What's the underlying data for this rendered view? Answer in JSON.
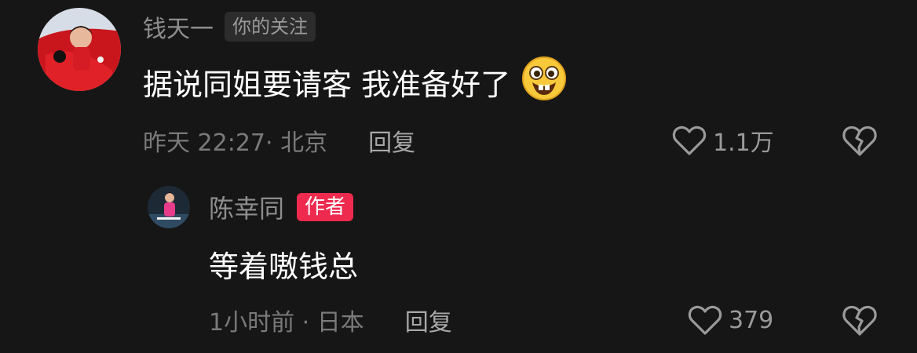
{
  "comments": [
    {
      "username": "钱天一",
      "tag": "你的关注",
      "text": "据说同姐要请客 我准备好了",
      "emoji": "grinning-face-emoji",
      "meta": "昨天 22:27· 北京",
      "reply_label": "回复",
      "likes": "1.1万",
      "icons": {
        "like": "heart-outline-icon",
        "dislike": "broken-heart-icon"
      }
    }
  ],
  "replies": [
    {
      "username": "陈幸同",
      "tag": "作者",
      "text": "等着嗷钱总",
      "meta": "1小时前 · 日本",
      "reply_label": "回复",
      "likes": "379",
      "icons": {
        "like": "heart-outline-icon",
        "dislike": "broken-heart-icon"
      }
    }
  ],
  "colors": {
    "background": "#161616",
    "author_tag": "#ee2a4e",
    "follow_tag_bg": "#2c2c2c",
    "meta_text": "#7a7a7a"
  }
}
